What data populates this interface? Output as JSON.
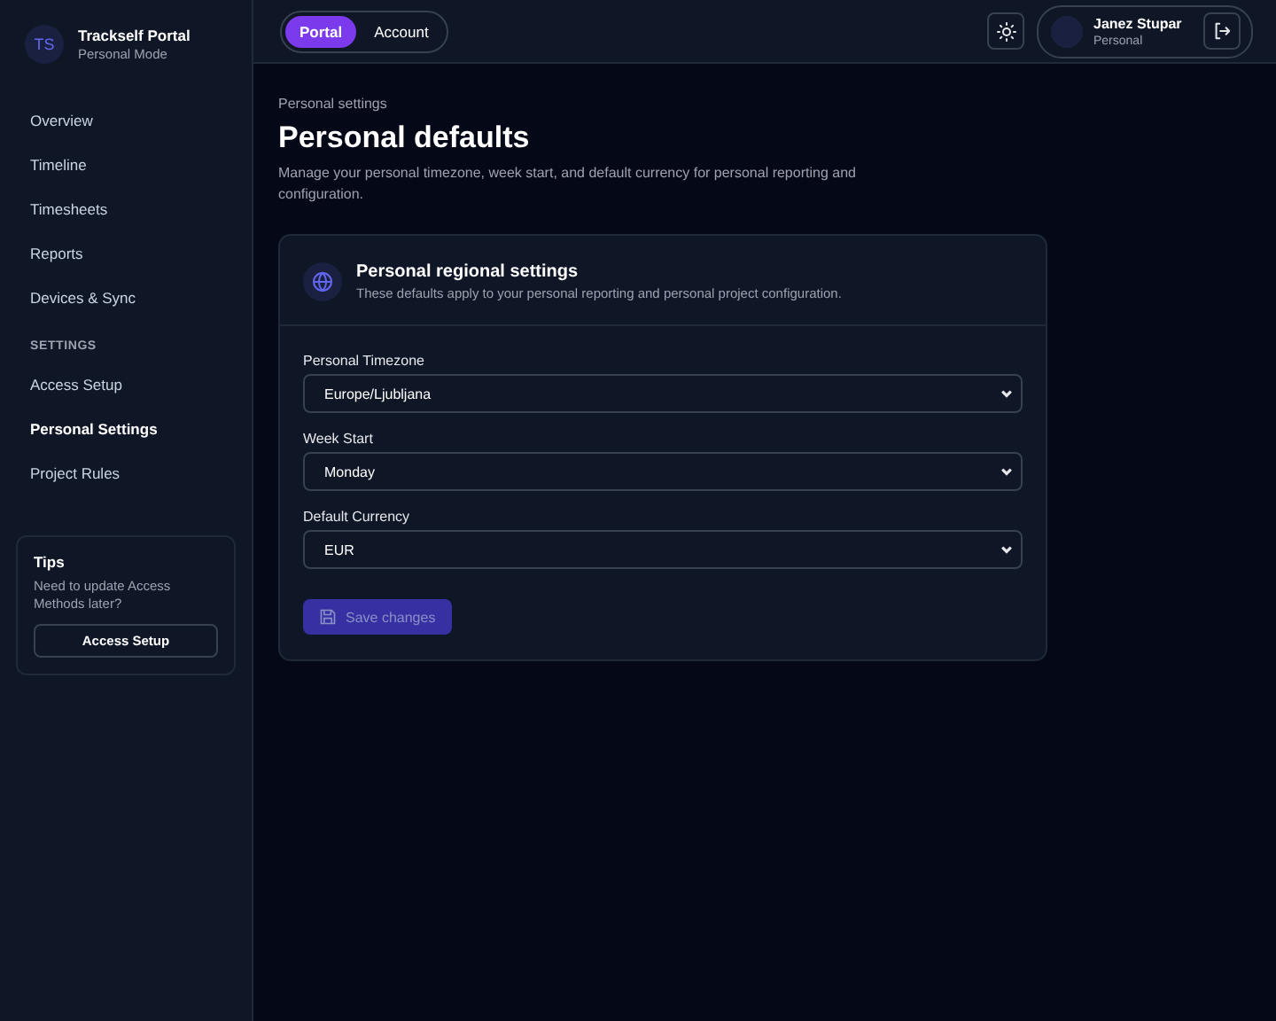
{
  "brand": {
    "initials": "TS",
    "name": "Trackself Portal",
    "mode": "Personal Mode"
  },
  "sidebar": {
    "items": [
      {
        "label": "Overview",
        "selected": false
      },
      {
        "label": "Timeline",
        "selected": false
      },
      {
        "label": "Timesheets",
        "selected": false
      },
      {
        "label": "Reports",
        "selected": false
      },
      {
        "label": "Devices & Sync",
        "selected": false
      }
    ],
    "section": "SETTINGS",
    "settings_items": [
      {
        "label": "Access Setup",
        "selected": false
      },
      {
        "label": "Personal Settings",
        "selected": true
      },
      {
        "label": "Project Rules",
        "selected": false
      }
    ],
    "tips": {
      "title": "Tips",
      "text": "Need to update Access Methods later?",
      "button": "Access Setup"
    }
  },
  "top_tabs": [
    {
      "label": "Portal",
      "selected": true
    },
    {
      "label": "Account",
      "selected": false
    }
  ],
  "user": {
    "name": "Janez Stupar",
    "role": "Personal"
  },
  "breadcrumb": "Personal settings",
  "title": "Personal defaults",
  "description": "Manage your personal timezone, week start, and default currency for personal reporting and configuration.",
  "card": {
    "title": "Personal regional settings",
    "subtitle": "These defaults apply to your personal reporting and personal project configuration.",
    "fields": [
      {
        "label": "Personal Timezone",
        "value": "Europe/Ljubljana"
      },
      {
        "label": "Week Start",
        "value": "Monday"
      },
      {
        "label": "Default Currency",
        "value": "EUR"
      }
    ],
    "save": {
      "label": "Save changes",
      "disabled": true
    }
  }
}
